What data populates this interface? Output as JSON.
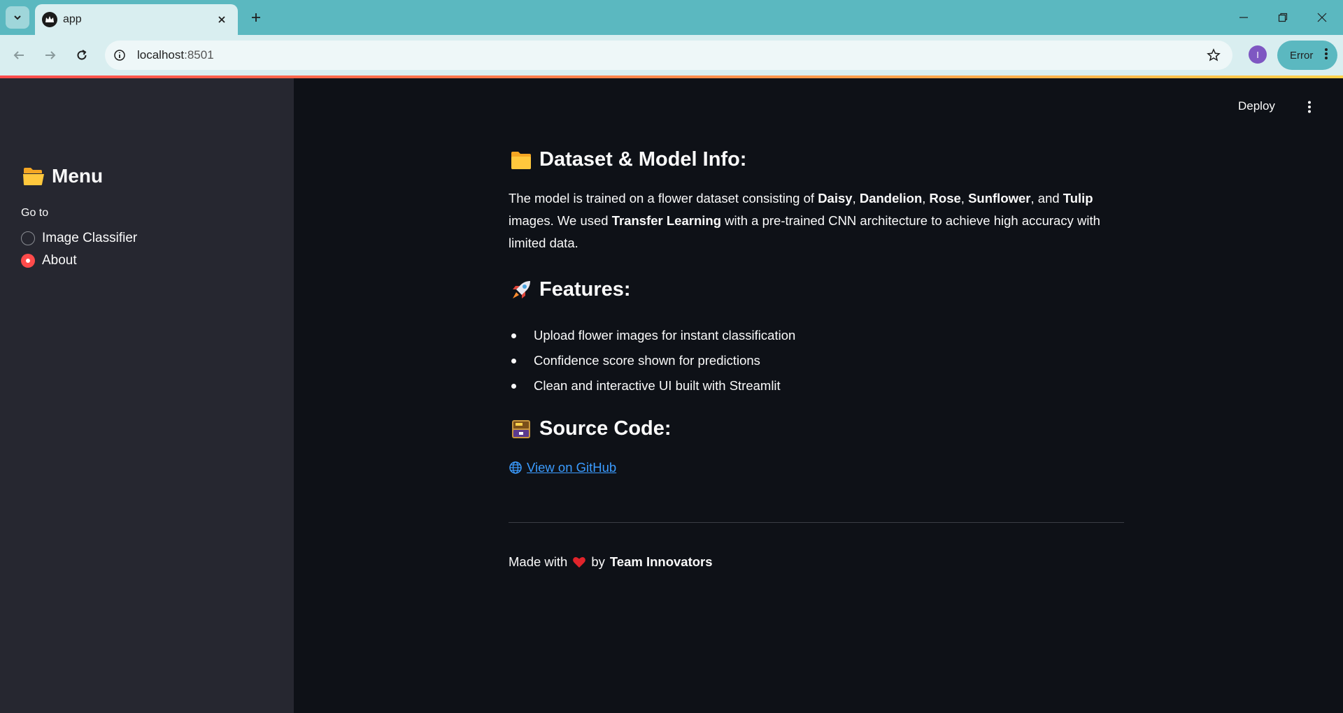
{
  "browser": {
    "tab_title": "app",
    "url_host": "localhost",
    "url_port": ":8501",
    "profile_initial": "I",
    "error_label": "Error"
  },
  "sidebar": {
    "title": "Menu",
    "title_icon": "open-folder-icon",
    "goto_label": "Go to",
    "options": [
      {
        "label": "Image Classifier",
        "selected": false
      },
      {
        "label": "About",
        "selected": true
      }
    ]
  },
  "header": {
    "deploy_label": "Deploy"
  },
  "main": {
    "dataset_heading": "Dataset & Model Info:",
    "dataset_para": {
      "t1": "The model is trained on a flower dataset consisting of ",
      "f1": "Daisy",
      "s1": ", ",
      "f2": "Dandelion",
      "s2": ", ",
      "f3": "Rose",
      "s3": ", ",
      "f4": "Sunflower",
      "s4": ", and ",
      "f5": "Tulip",
      "t2": " images. We used ",
      "tl": "Transfer Learning",
      "t3": " with a pre-trained CNN architecture to achieve high accuracy with limited data."
    },
    "features_heading": "Features:",
    "features": [
      "Upload flower images for instant classification",
      "Confidence score shown for predictions",
      "Clean and interactive UI built with Streamlit"
    ],
    "source_heading": "Source Code:",
    "github_link": "View on GitHub",
    "footer": {
      "made_with": "Made with",
      "by": "by",
      "team": "Team Innovators"
    }
  },
  "colors": {
    "accent": "#ff4b4b",
    "link": "#3b9cff",
    "sidebar_bg": "#262730",
    "main_bg": "#0e1117",
    "tabstrip": "#5bb8c0"
  }
}
